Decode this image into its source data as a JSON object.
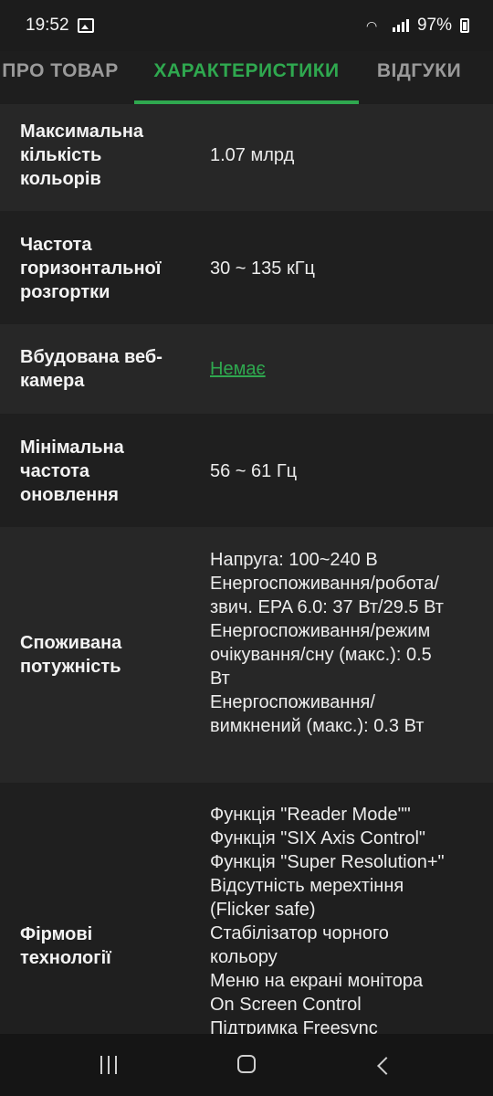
{
  "status": {
    "time": "19:52",
    "battery": "97%"
  },
  "tabs": [
    {
      "label": "ПРО ТОВАР",
      "active": false
    },
    {
      "label": "ХАРАКТЕРИСТИКИ",
      "active": true
    },
    {
      "label": "ВІДГУКИ",
      "active": false
    }
  ],
  "specs": [
    {
      "label": [
        "Максимальна",
        "кількість",
        "кольорів"
      ],
      "value": [
        "1.07 млрд"
      ]
    },
    {
      "label": [
        "Частота",
        "горизонтальної",
        "розгортки"
      ],
      "value": [
        "30 ~ 135 кГц"
      ]
    },
    {
      "label": [
        "Вбудована",
        "веб-камера"
      ],
      "value": [
        "Немає"
      ]
    },
    {
      "label": [
        "Мінімальна",
        "частота",
        "оновлення"
      ],
      "value": [
        "56 ~ 61 Гц"
      ]
    },
    {
      "label": [
        "Споживана",
        "потужність"
      ],
      "value": [
        "Напруга: 100~240 В",
        "Енергоспоживання/робота/",
        "звич. EPA 6.0: 37 Вт/29.5 Вт",
        "Енергоспоживання/режим",
        "очікування/сну (макс.): 0.5",
        "Вт",
        "Енергоспоживання/",
        "вимкнений (макс.): 0.3 Вт"
      ]
    },
    {
      "label": [
        "Фірмові",
        "технології"
      ],
      "value": [
        "Функція \"Reader Mode\"\"",
        "Функція \"SIX Axis Control\"",
        "Функція \"Super Resolution+\"",
        "Відсутність мерехтіння",
        "(Flicker safe)",
        "Стабілізатор чорного",
        "кольору",
        "Меню на екрані монітора",
        "On Screen Control",
        "Підтримка Freesync"
      ]
    }
  ]
}
